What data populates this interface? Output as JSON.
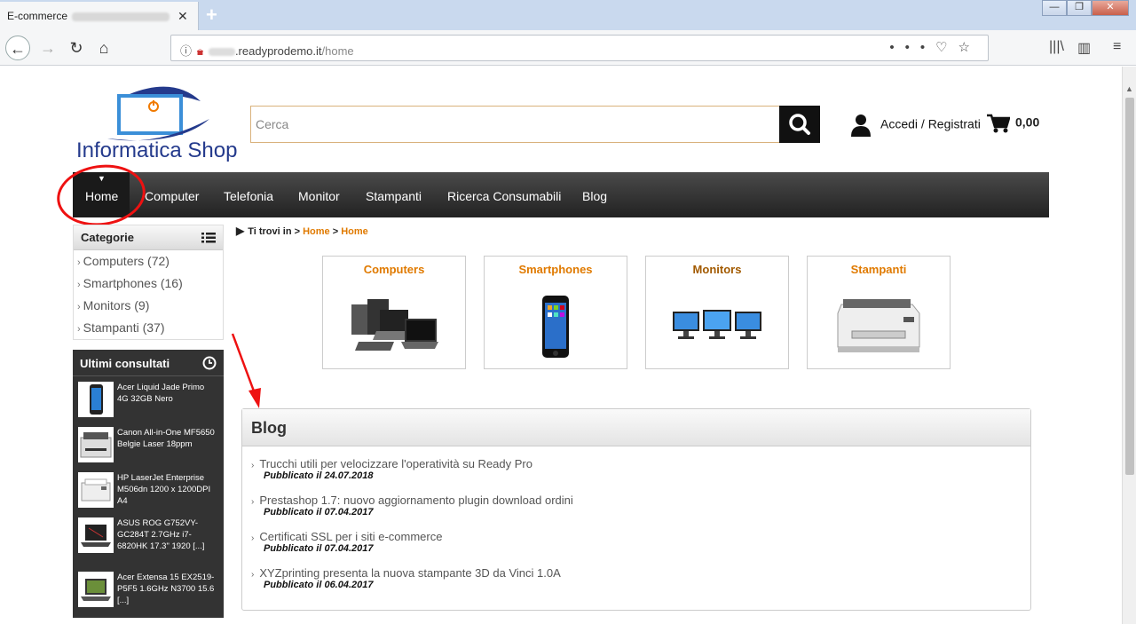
{
  "browser": {
    "tab_title": "E-commerce",
    "url_domain": ".readyprodemo.it",
    "url_path": "/home"
  },
  "header": {
    "logo_text": "Informatica Shop",
    "search_placeholder": "Cerca",
    "login_label": "Accedi / Registrati",
    "cart_total": "0,00"
  },
  "menu": {
    "items": [
      "Home",
      "Computer",
      "Telefonia",
      "Monitor",
      "Stampanti",
      "Ricerca Consumabili",
      "Blog"
    ]
  },
  "categories": {
    "title": "Categorie",
    "items": [
      "Computers (72)",
      "Smartphones (16)",
      "Monitors (9)",
      "Stampanti (37)"
    ]
  },
  "recent": {
    "title": "Ultimi consultati",
    "items": [
      "Acer Liquid Jade Primo 4G 32GB Nero",
      "Canon All-in-One MF5650 Belgie Laser 18ppm",
      "HP LaserJet Enterprise M506dn 1200 x 1200DPI A4",
      "ASUS ROG G752VY-GC284T 2.7GHz i7-6820HK 17.3\" 1920 [...]",
      "Acer Extensa 15 EX2519-P5F5 1.6GHz N3700 15.6 [...]"
    ]
  },
  "breadcrumb": {
    "prefix": "Ti trovi in",
    "sep": ">",
    "crumbs": [
      "Home",
      "Home"
    ]
  },
  "tiles": [
    "Computers",
    "Smartphones",
    "Monitors",
    "Stampanti"
  ],
  "blog": {
    "title": "Blog",
    "posts": [
      {
        "title": "Trucchi utili per velocizzare l'operatività su Ready Pro",
        "date": "Pubblicato il 24.07.2018"
      },
      {
        "title": "Prestashop 1.7: nuovo aggiornamento plugin download ordini",
        "date": "Pubblicato il 07.04.2017"
      },
      {
        "title": "Certificati SSL per i siti e-commerce",
        "date": "Pubblicato il 07.04.2017"
      },
      {
        "title": "XYZprinting presenta la nuova stampante 3D da Vinci 1.0A",
        "date": "Pubblicato il 06.04.2017"
      }
    ]
  }
}
